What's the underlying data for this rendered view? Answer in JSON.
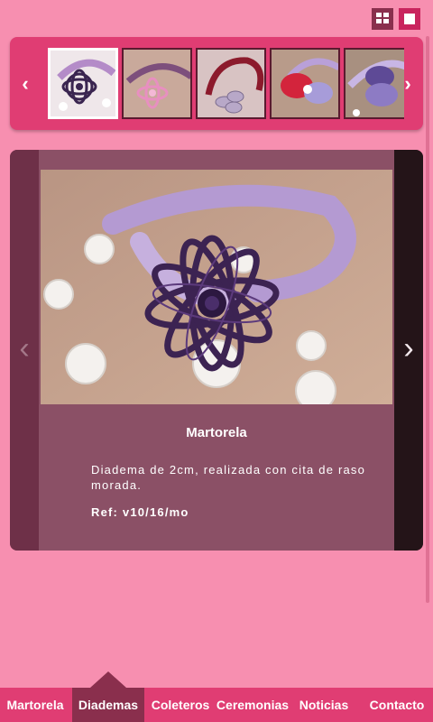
{
  "colors": {
    "page_bg": "#f78fb0",
    "accent": "#e03d73",
    "accent_dark": "#8a2f4d",
    "panel_bg": "#8b5066"
  },
  "toolbar": {
    "grid_view_icon": "grid-view-icon",
    "single_view_icon": "single-view-icon"
  },
  "thumbnail_strip": {
    "prev_icon": "chevron-left-icon",
    "next_icon": "chevron-right-icon",
    "prev_glyph": "‹",
    "next_glyph": "›",
    "thumbnails": [
      {
        "label": "purple flower headband",
        "active": true
      },
      {
        "label": "pink flower headband",
        "active": false
      },
      {
        "label": "red headband with lilac flower",
        "active": false
      },
      {
        "label": "red and lilac bow headband",
        "active": false
      },
      {
        "label": "lilac flower headband",
        "active": false
      }
    ]
  },
  "product": {
    "title": "Martorela",
    "description": "Diadema de 2cm, realizada con cita de raso morada.",
    "reference": "Ref: v10/16/mo",
    "prev_glyph": "‹",
    "next_glyph": "›"
  },
  "bottom_nav": {
    "items": [
      {
        "label": "Martorela",
        "active": false
      },
      {
        "label": "Diademas",
        "active": true
      },
      {
        "label": "Coleteros",
        "active": false
      },
      {
        "label": "Ceremonias",
        "active": false
      },
      {
        "label": "Noticias",
        "active": false
      },
      {
        "label": "Contacto",
        "active": false
      }
    ]
  }
}
